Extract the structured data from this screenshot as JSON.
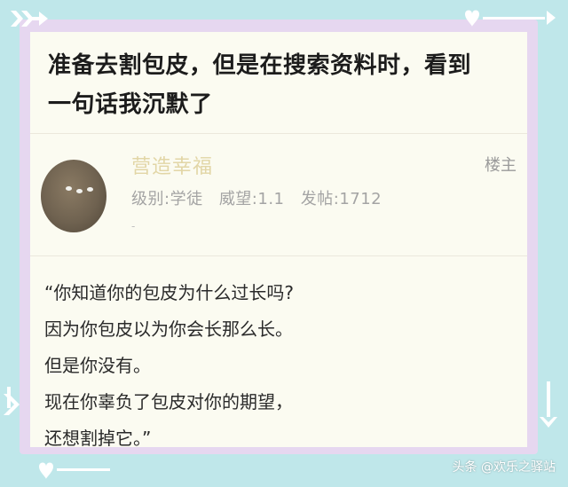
{
  "post": {
    "title_line1": "准备去割包皮，但是在搜索资料时，看到",
    "title_line2": "一句话我沉默了"
  },
  "author": {
    "username": "营造幸福",
    "badge": "楼主",
    "level_label": "级别:学徒",
    "reputation_label": "威望:1.1",
    "posts_label": "发帖:1712",
    "extra": "-"
  },
  "content": {
    "lines": [
      "“你知道你的包皮为什么过长吗?",
      "因为你包皮以为你会长那么长。",
      "但是你没有。",
      "现在你辜负了包皮对你的期望，",
      "还想割掉它。”"
    ]
  },
  "watermark": "头条 @欢乐之驿站",
  "colors": {
    "background": "#bfe7ea",
    "frame": "#e6d7f0",
    "card": "#fbfbf1",
    "username": "#e2d6a6",
    "meta": "#a4a4a4"
  }
}
